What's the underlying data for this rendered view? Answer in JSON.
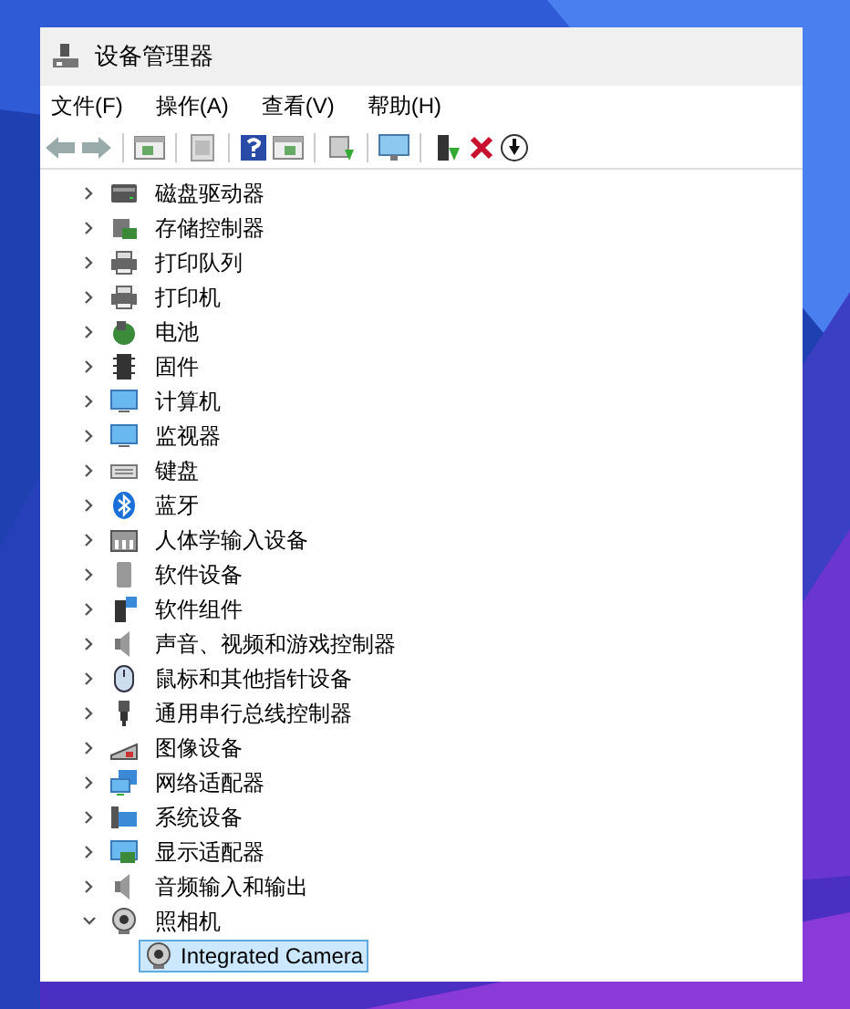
{
  "window": {
    "title": "设备管理器"
  },
  "menu": [
    {
      "label": "文件(F)"
    },
    {
      "label": "操作(A)"
    },
    {
      "label": "查看(V)"
    },
    {
      "label": "帮助(H)"
    }
  ],
  "tree": [
    {
      "label": "磁盘驱动器",
      "expanded": false,
      "selected": false
    },
    {
      "label": "存储控制器",
      "expanded": false,
      "selected": false
    },
    {
      "label": "打印队列",
      "expanded": false,
      "selected": false
    },
    {
      "label": "打印机",
      "expanded": false,
      "selected": false
    },
    {
      "label": "电池",
      "expanded": false,
      "selected": false
    },
    {
      "label": "固件",
      "expanded": false,
      "selected": false
    },
    {
      "label": "计算机",
      "expanded": false,
      "selected": false
    },
    {
      "label": "监视器",
      "expanded": false,
      "selected": false
    },
    {
      "label": "键盘",
      "expanded": false,
      "selected": false
    },
    {
      "label": "蓝牙",
      "expanded": false,
      "selected": false
    },
    {
      "label": "人体学输入设备",
      "expanded": false,
      "selected": false
    },
    {
      "label": "软件设备",
      "expanded": false,
      "selected": false
    },
    {
      "label": "软件组件",
      "expanded": false,
      "selected": false
    },
    {
      "label": "声音、视频和游戏控制器",
      "expanded": false,
      "selected": false
    },
    {
      "label": "鼠标和其他指针设备",
      "expanded": false,
      "selected": false
    },
    {
      "label": "通用串行总线控制器",
      "expanded": false,
      "selected": false
    },
    {
      "label": "图像设备",
      "expanded": false,
      "selected": false
    },
    {
      "label": "网络适配器",
      "expanded": false,
      "selected": false
    },
    {
      "label": "系统设备",
      "expanded": false,
      "selected": false
    },
    {
      "label": "显示适配器",
      "expanded": false,
      "selected": false
    },
    {
      "label": "音频输入和输出",
      "expanded": false,
      "selected": false
    },
    {
      "label": "照相机",
      "expanded": true,
      "selected": false,
      "children": [
        {
          "label": "Integrated Camera",
          "selected": true
        }
      ]
    }
  ]
}
